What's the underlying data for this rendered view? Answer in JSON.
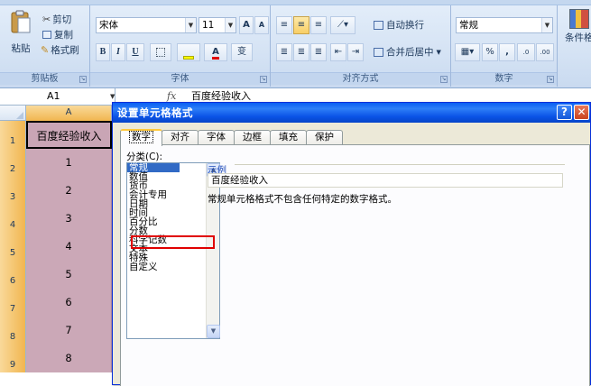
{
  "ribbon": {
    "clipboard": {
      "paste": "粘贴",
      "cut": "剪切",
      "copy": "复制",
      "format_painter": "格式刷",
      "group_label": "剪贴板"
    },
    "font": {
      "font_name": "宋体",
      "font_size": "11",
      "grow": "A",
      "shrink": "A",
      "bold": "B",
      "italic": "I",
      "underline": "U",
      "font_color_letter": "A",
      "phonetic": "变",
      "group_label": "字体"
    },
    "alignment": {
      "wrap_text": "自动换行",
      "merge_center": "合并后居中",
      "group_label": "对齐方式"
    },
    "number": {
      "format": "常规",
      "percent": "%",
      "comma": ",",
      "inc_decimal": ".0",
      "dec_decimal": ".00",
      "group_label": "数字"
    },
    "styles": {
      "conditional_format": "条件格"
    }
  },
  "formula_bar": {
    "name_box": "A1",
    "fx": "fx",
    "value": "百度经验收入"
  },
  "sheet": {
    "column_header": "A",
    "rows": [
      {
        "num": "1",
        "value": "百度经验收入"
      },
      {
        "num": "2",
        "value": "1"
      },
      {
        "num": "3",
        "value": "2"
      },
      {
        "num": "4",
        "value": "3"
      },
      {
        "num": "5",
        "value": "4"
      },
      {
        "num": "6",
        "value": "5"
      },
      {
        "num": "7",
        "value": "6"
      },
      {
        "num": "8",
        "value": "7"
      },
      {
        "num": "9",
        "value": "8"
      }
    ]
  },
  "dialog": {
    "title": "设置单元格格式",
    "help": "?",
    "close": "✕",
    "tabs": [
      "数字",
      "对齐",
      "字体",
      "边框",
      "填充",
      "保护"
    ],
    "category_label": "分类(C):",
    "categories": [
      "常规",
      "数值",
      "货币",
      "会计专用",
      "日期",
      "时间",
      "百分比",
      "分数",
      "科学记数",
      "文本",
      "特殊",
      "自定义"
    ],
    "selected_category": "常规",
    "highlighted_category": "百分比",
    "sample_label": "示例",
    "sample_value": "百度经验收入",
    "description": "常规单元格格式不包含任何特定的数字格式。"
  },
  "colors": {
    "titlebar": "#0a53e6",
    "cell_fill": "#cba8b7",
    "selection": "#316ac5",
    "highlight_box": "#e00000"
  }
}
